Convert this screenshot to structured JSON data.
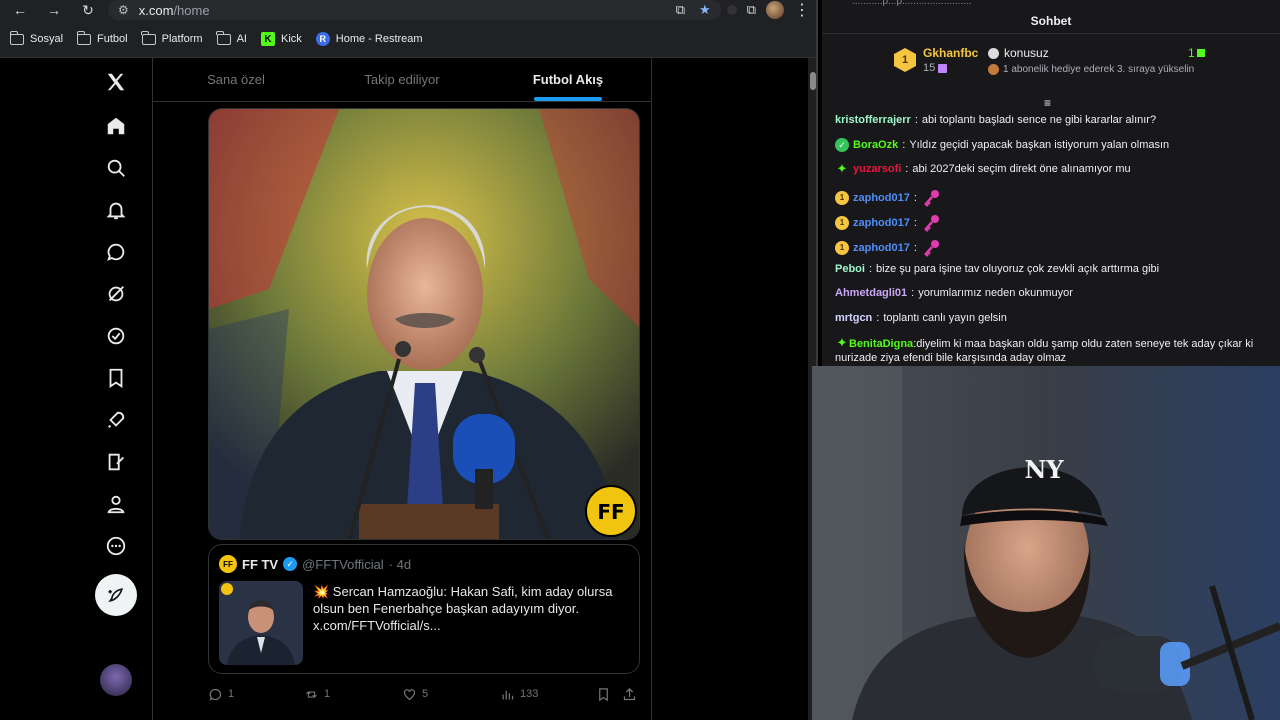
{
  "browser": {
    "url_host": "x.com",
    "url_path": "/home",
    "bookmarks": [
      {
        "label": "Sosyal",
        "icon": "folder-icon"
      },
      {
        "label": "Futbol",
        "icon": "folder-icon"
      },
      {
        "label": "Platform",
        "icon": "folder-icon"
      },
      {
        "label": "AI",
        "icon": "folder-icon"
      },
      {
        "label": "Kick",
        "icon": "kick-icon"
      },
      {
        "label": "Home - Restream",
        "icon": "restream-icon"
      }
    ]
  },
  "x": {
    "tabs": [
      {
        "label": "Sana özel",
        "active": false
      },
      {
        "label": "Takip ediliyor",
        "active": false
      },
      {
        "label": "Futbol Akış",
        "active": true
      }
    ],
    "media_logo": "FF",
    "quote": {
      "avatar": "FF",
      "name": "FF TV",
      "handle": "@FFTVofficial",
      "time": "· 4d",
      "text_line1": "💥 Sercan Hamzaoğlu: Hakan Safi, kim aday olursa",
      "text_line2": "olsun ben Fenerbahçe başkan adayıyım diyor.",
      "text_line3": "x.com/FFTVofficial/s..."
    },
    "actions": {
      "replies": "1",
      "reposts": "1",
      "likes": "5",
      "views": "133"
    },
    "accent": "#1d9bf0"
  },
  "chat": {
    "cut_text": "...........p...p.........................",
    "title": "Sohbet",
    "leader": {
      "rank": "1",
      "name": "Gkhanfbc",
      "count": "15",
      "label": "konusuz",
      "num": "1",
      "hint": "1 abonelik hediye ederek 3. sıraya yükselin"
    },
    "messages": [
      {
        "badge": "",
        "user": "kristofferrajerr",
        "color": "#9ef7c9",
        "text": "abi toplantı başladı sence ne gibi kararlar alınır?"
      },
      {
        "badge": "check",
        "user": "BoraOzk",
        "color": "#53fc18",
        "text": "Yıldız geçidi yapacak başkan istiyorum yalan olmasın"
      },
      {
        "badge": "spark",
        "user": "yuzarsofi",
        "color": "#e5183d",
        "text": "abi 2027deki seçim direkt öne alınamıyor mu"
      },
      {
        "badge": "one",
        "user": "zaphod017",
        "color": "#4f8ff7",
        "text": "",
        "emote": true
      },
      {
        "badge": "one",
        "user": "zaphod017",
        "color": "#4f8ff7",
        "text": "",
        "emote": true
      },
      {
        "badge": "one",
        "user": "zaphod017",
        "color": "#4f8ff7",
        "text": "",
        "emote": true
      },
      {
        "badge": "",
        "user": "Peboi",
        "color": "#9ef7c9",
        "text": "bize şu para işine tav oluyoruz çok zevkli açık arttırma gibi"
      },
      {
        "badge": "",
        "user": "Ahmetdagli01",
        "color": "#c9a7f5",
        "text": "yorumlarımız neden okunmuyor"
      },
      {
        "badge": "",
        "user": "mrtgcn",
        "color": "#d4d4ff",
        "text": "toplantı canlı yayın gelsin"
      },
      {
        "badge": "spark",
        "user": "BenitaDigna",
        "color": "#53fc18",
        "text": "diyelim ki maa başkan oldu şamp oldu zaten seneye tek aday çıkar ki nurizade ziya efendi bile karşısında aday olmaz"
      }
    ],
    "badge_one_label": "1"
  },
  "cam": {
    "cap_logo": "NY"
  }
}
